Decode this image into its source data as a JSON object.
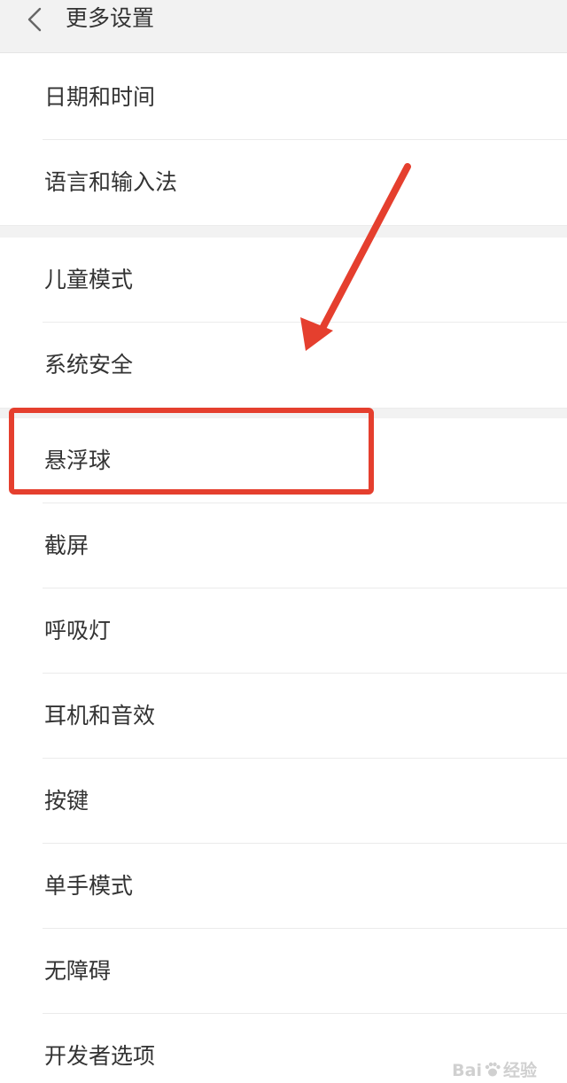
{
  "header": {
    "title": "更多设置",
    "back_icon": "chevron-left-icon"
  },
  "groups": [
    {
      "items": [
        "日期和时间",
        "语言和输入法"
      ]
    },
    {
      "items": [
        "儿童模式",
        "系统安全"
      ]
    },
    {
      "items": [
        "悬浮球",
        "截屏",
        "呼吸灯",
        "耳机和音效",
        "按键",
        "单手模式",
        "无障碍",
        "开发者选项"
      ]
    }
  ],
  "annotation": {
    "highlighted_item": "悬浮球",
    "color": "#e53f2e"
  },
  "watermark": {
    "brand_left": "Bai",
    "brand_right": "经验",
    "icon": "paw-icon"
  }
}
